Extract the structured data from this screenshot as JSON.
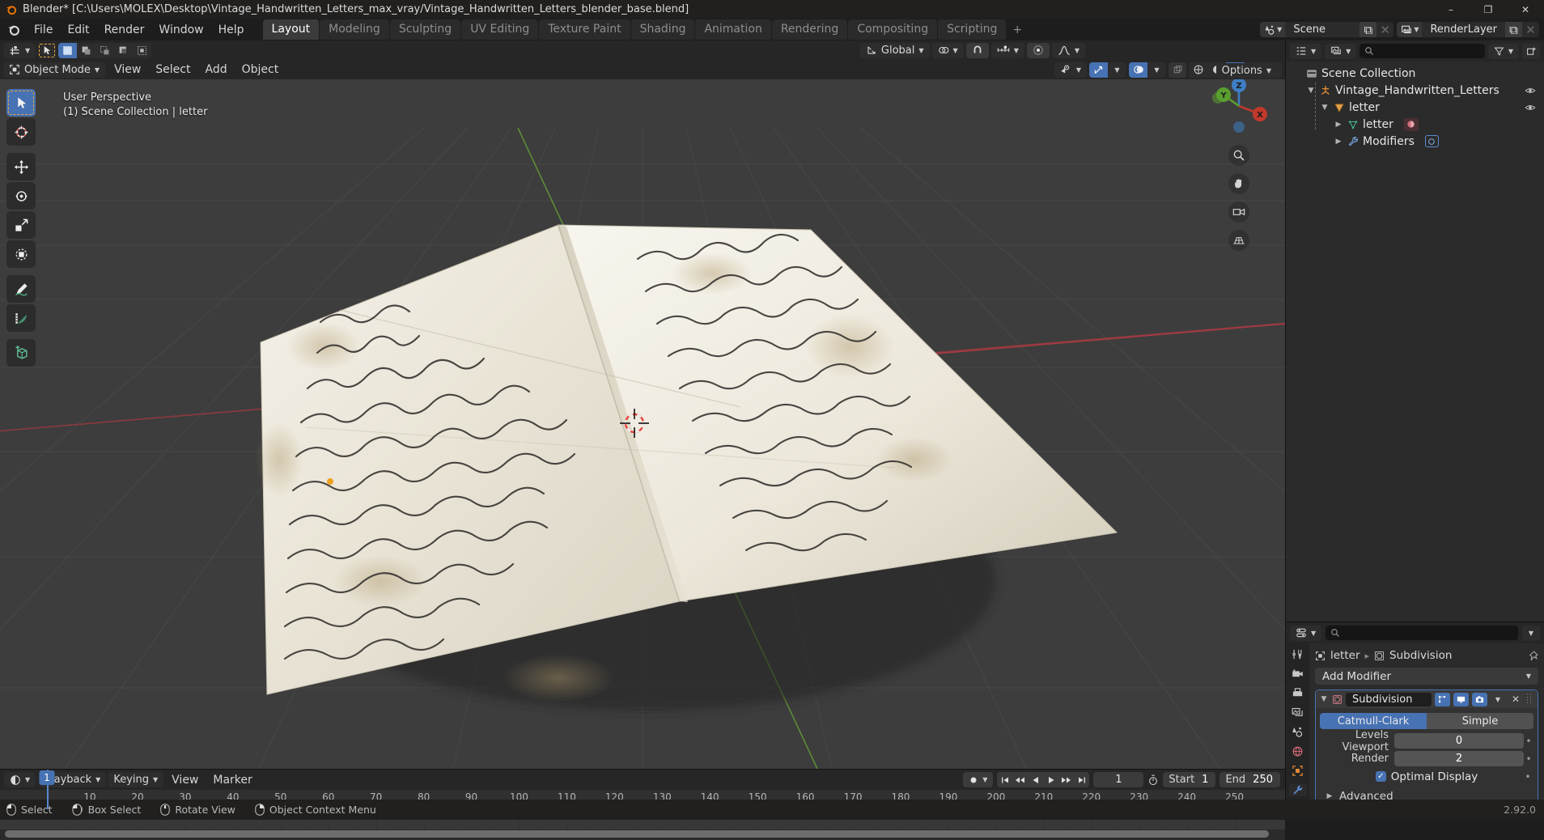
{
  "window": {
    "title": "Blender* [C:\\Users\\MOLEX\\Desktop\\Vintage_Handwritten_Letters_max_vray/Vintage_Handwritten_Letters_blender_base.blend]",
    "minimize": "–",
    "maximize": "❐",
    "close": "✕"
  },
  "menus": [
    "File",
    "Edit",
    "Render",
    "Window",
    "Help"
  ],
  "workspace_tabs": [
    {
      "label": "Layout",
      "active": true
    },
    {
      "label": "Modeling",
      "active": false
    },
    {
      "label": "Sculpting",
      "active": false
    },
    {
      "label": "UV Editing",
      "active": false
    },
    {
      "label": "Texture Paint",
      "active": false
    },
    {
      "label": "Shading",
      "active": false
    },
    {
      "label": "Animation",
      "active": false
    },
    {
      "label": "Rendering",
      "active": false
    },
    {
      "label": "Compositing",
      "active": false
    },
    {
      "label": "Scripting",
      "active": false
    },
    {
      "label": "+",
      "active": false
    }
  ],
  "topbar_right": {
    "scene_name": "Scene",
    "viewlayer_name": "RenderLayer",
    "new_label": "⧉",
    "unlink_label": "✕"
  },
  "viewport": {
    "mode": "Object Mode",
    "menus": [
      "View",
      "Select",
      "Add",
      "Object"
    ],
    "transform_orientation": "Global",
    "options_label": "Options",
    "overlay_line1": "User Perspective",
    "overlay_line2": "(1) Scene Collection | letter",
    "gizmo_axes": [
      "X",
      "Y",
      "Z"
    ],
    "toolbar_icons": [
      "tweak-select-icon",
      "cursor-icon",
      "move-icon",
      "rotate-icon",
      "scale-icon",
      "transform-icon",
      "annotate-icon",
      "measure-icon",
      "add-cube-icon"
    ]
  },
  "outliner": {
    "search_placeholder": "",
    "rows": [
      {
        "label": "Scene Collection",
        "indent": 0,
        "icon": "collection-icon",
        "tri": "",
        "eye": false
      },
      {
        "label": "Vintage_Handwritten_Letters",
        "indent": 1,
        "icon": "collection-orange-icon",
        "tri": "▼",
        "eye": true
      },
      {
        "label": "letter",
        "indent": 2,
        "icon": "object-mesh-icon",
        "tri": "▼",
        "eye": true
      },
      {
        "label": "letter",
        "indent": 3,
        "icon": "mesh-data-icon",
        "tri": "▶",
        "eye": false,
        "badge": "material-icon"
      },
      {
        "label": "Modifiers",
        "indent": 3,
        "icon": "wrench-icon",
        "tri": "▶",
        "eye": false,
        "badge": "subdiv-icon"
      }
    ]
  },
  "properties": {
    "breadcrumb_object": "letter",
    "breadcrumb_modifier": "Subdivision",
    "add_modifier_label": "Add Modifier",
    "modifier": {
      "name": "Subdivision",
      "subdivision_type_options": [
        "Catmull-Clark",
        "Simple"
      ],
      "subdivision_type_selected": "Catmull-Clark",
      "levels_viewport_label": "Levels Viewport",
      "levels_viewport_value": "0",
      "render_label": "Render",
      "render_value": "2",
      "optimal_display_label": "Optimal Display",
      "optimal_display_checked": true,
      "advanced_label": "Advanced",
      "close_label": "✕"
    },
    "tabs": [
      "tool-icon",
      "render-icon",
      "output-icon",
      "viewlayer-icon",
      "scene-icon",
      "world-icon",
      "object-icon",
      "modifier-icon",
      "particles-icon"
    ]
  },
  "timeline": {
    "menus": [
      "Playback",
      "Keying",
      "View",
      "Marker"
    ],
    "current_frame": "1",
    "start_label": "Start",
    "start_value": "1",
    "end_label": "End",
    "end_value": "250",
    "ticks": [
      10,
      20,
      30,
      40,
      50,
      60,
      70,
      80,
      90,
      100,
      110,
      120,
      130,
      140,
      150,
      160,
      170,
      180,
      190,
      200,
      210,
      220,
      230,
      240,
      250
    ],
    "playhead_frame": "1"
  },
  "statusbar": {
    "items": [
      {
        "icon": "mouse-left-icon",
        "label": "Select"
      },
      {
        "icon": "mouse-left-drag-icon",
        "label": "Box Select"
      },
      {
        "icon": "mouse-middle-icon",
        "label": "Rotate View"
      },
      {
        "icon": "mouse-right-icon",
        "label": "Object Context Menu"
      }
    ],
    "version": "2.92.0"
  },
  "colors": {
    "accent": "#4772b3",
    "orange": "#e8a33d",
    "bg_dark": "#1d1d1d",
    "panel": "#2b2b2b",
    "viewport": "#3b3b3b"
  }
}
